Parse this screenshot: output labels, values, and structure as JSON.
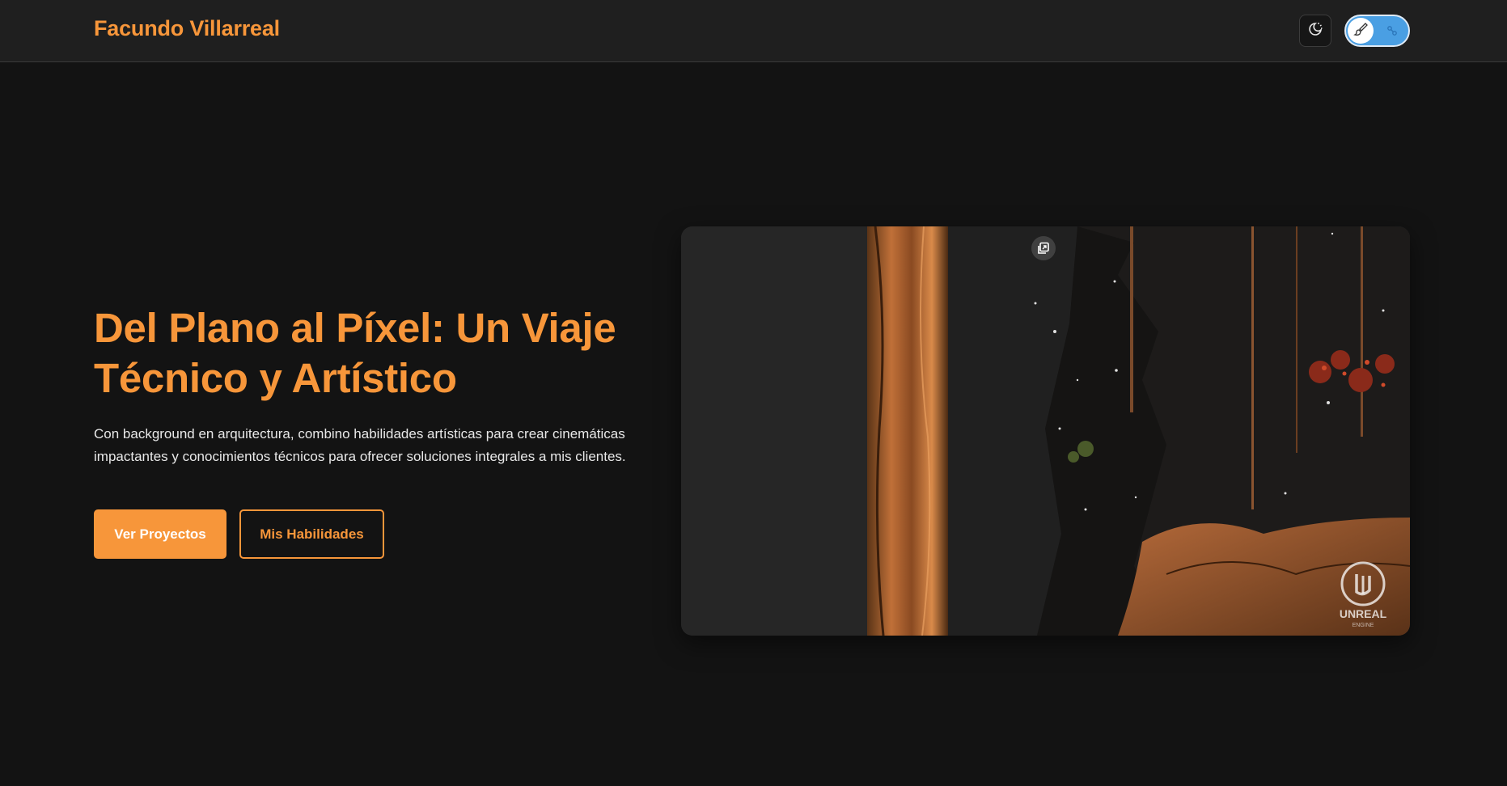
{
  "header": {
    "brand": "Facundo Villarreal",
    "theme_icon": "moon-sun-icon",
    "mode_toggle": {
      "left_icon": "paintbrush-icon",
      "right_icon": "dev-icon",
      "active": "art"
    }
  },
  "hero": {
    "title": "Del Plano al Píxel: Un Viaje Técnico y Artístico",
    "description": "Con background en arquitectura, combino habilidades artísticas para crear cinemáticas impactantes y conocimientos técnicos para ofrecer soluciones integrales a mis clientes.",
    "primary_button": "Ver Proyectos",
    "secondary_button": "Mis Habilidades"
  },
  "media": {
    "expand_icon": "expand-icon",
    "logo": "unreal-engine-logo",
    "logo_text": "UNREAL",
    "logo_subtext": "ENGINE"
  },
  "colors": {
    "accent": "#f7963a",
    "background": "#131313",
    "header_bg": "#1f1f1f",
    "toggle_blue": "#4a9fe3"
  }
}
